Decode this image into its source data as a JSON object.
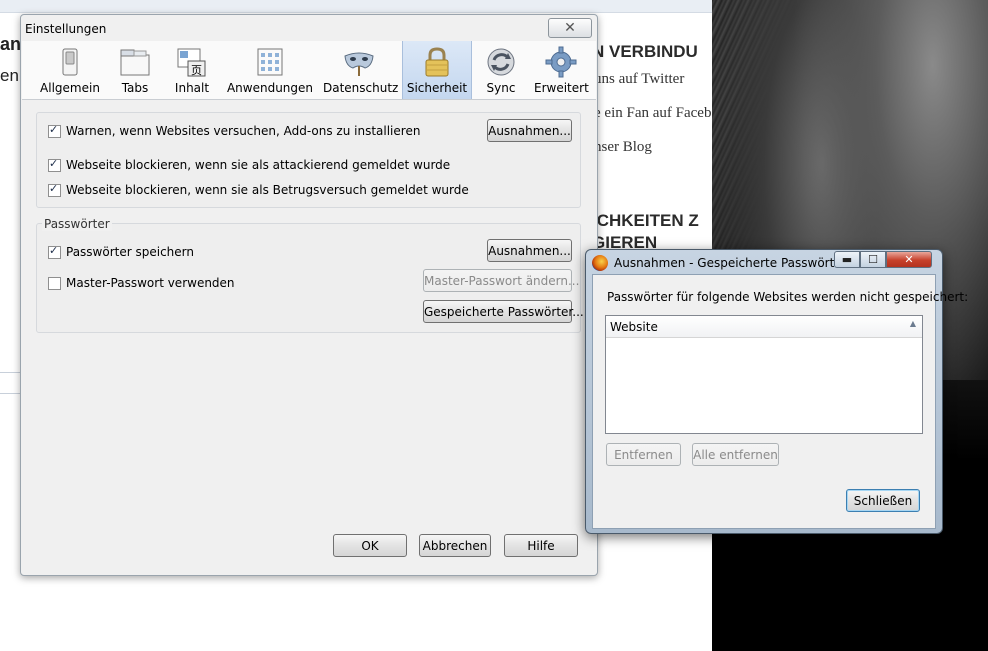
{
  "background_page": {
    "fragment_left_1": "an",
    "fragment_left_2": "en",
    "heading_connect": "N VERBINDU",
    "links": [
      "uns auf Twitter",
      "e ein Fan auf Faceb",
      "nser Blog"
    ],
    "heading_options_1": "ICHKEITEN Z",
    "heading_options_2": "GIEREN"
  },
  "settings_dialog": {
    "title": "Einstellungen",
    "close_glyph": "✕",
    "tabs": [
      {
        "label": "Allgemein",
        "icon": "switch-icon"
      },
      {
        "label": "Tabs",
        "icon": "tabs-icon"
      },
      {
        "label": "Inhalt",
        "icon": "content-icon"
      },
      {
        "label": "Anwendungen",
        "icon": "applications-icon"
      },
      {
        "label": "Datenschutz",
        "icon": "privacy-mask-icon"
      },
      {
        "label": "Sicherheit",
        "icon": "padlock-icon",
        "active": true
      },
      {
        "label": "Sync",
        "icon": "sync-icon"
      },
      {
        "label": "Erweitert",
        "icon": "gear-icon"
      }
    ],
    "addons_warning": {
      "label": "Warnen, wenn Websites versuchen, Add-ons zu installieren",
      "checked": true
    },
    "block_attack": {
      "label": "Webseite blockieren, wenn sie als attackierend gemeldet wurde",
      "checked": true
    },
    "block_forgery": {
      "label": "Webseite blockieren, wenn sie als Betrugsversuch gemeldet wurde",
      "checked": true
    },
    "exceptions_button_1": "Ausnahmen...",
    "passwords_group": {
      "caption": "Passwörter",
      "save_passwords": {
        "label": "Passwörter speichern",
        "checked": true
      },
      "master_password": {
        "label": "Master-Passwort verwenden",
        "checked": false
      },
      "exceptions_button": "Ausnahmen...",
      "change_master_button": "Master-Passwort ändern...",
      "saved_passwords_button": "Gespeicherte Passwörter..."
    },
    "buttons": {
      "ok": "OK",
      "cancel": "Abbrechen",
      "help": "Hilfe"
    }
  },
  "exceptions_dialog": {
    "title": "Ausnahmen - Gespeicherte Passwörter",
    "description": "Passwörter für folgende Websites werden nicht gespeichert:",
    "column_header": "Website",
    "sort_glyph": "▲",
    "rows": [],
    "remove_button": "Entfernen",
    "remove_all_button": "Alle entfernen",
    "close_button": "Schließen",
    "caption_glyphs": {
      "minimize": "▬",
      "maximize": "☐",
      "close": "✕"
    }
  },
  "colors": {
    "active_tab": "#c4d7ef",
    "dialog_bg": "#f0f0f0",
    "close_red": "#c7402b"
  }
}
